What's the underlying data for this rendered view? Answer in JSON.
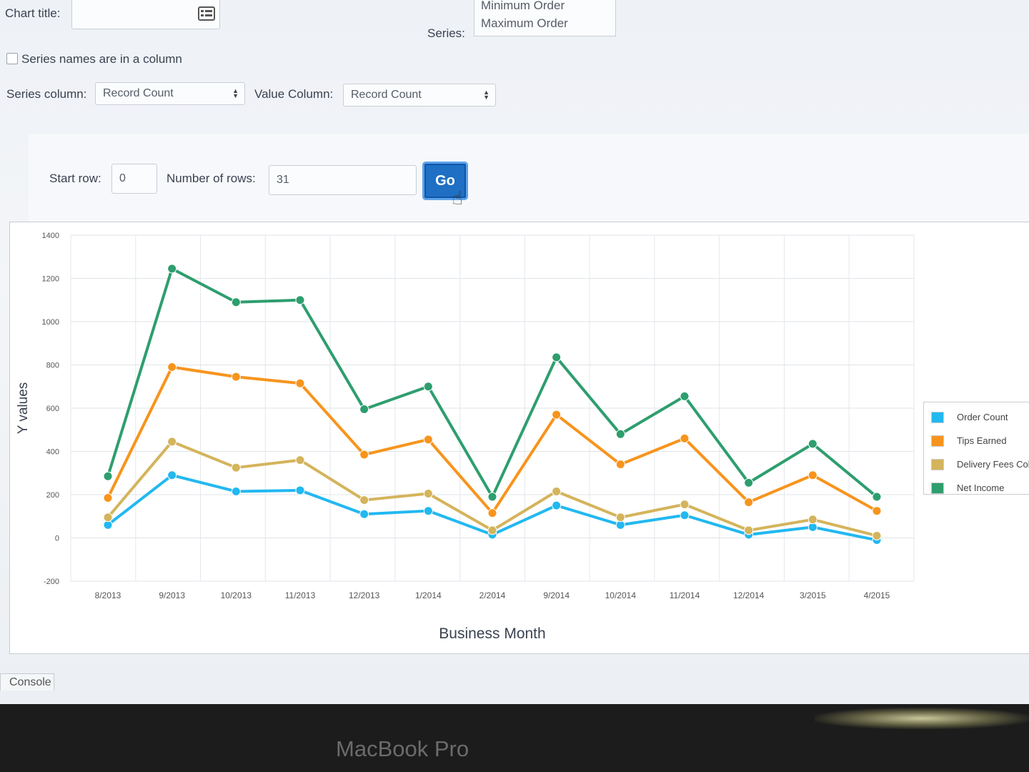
{
  "form": {
    "chart_title_label": "Chart title:",
    "chart_title_value": "",
    "series_label": "Series:",
    "series_options": [
      "Minimum Order",
      "Maximum Order"
    ],
    "series_names_in_column_label": "Series names are in a column",
    "series_names_in_column_checked": false,
    "series_column_label": "Series column:",
    "series_column_value": "Record Count",
    "value_column_label": "Value Column:",
    "value_column_value": "Record Count",
    "start_row_label": "Start row:",
    "start_row_value": "0",
    "num_rows_label": "Number of rows:",
    "num_rows_value": "31",
    "go_label": "Go"
  },
  "chart_data": {
    "type": "line",
    "categories": [
      "8/2013",
      "9/2013",
      "10/2013",
      "11/2013",
      "12/2013",
      "1/2014",
      "2/2014",
      "9/2014",
      "10/2014",
      "11/2014",
      "12/2014",
      "3/2015",
      "4/2015"
    ],
    "series": [
      {
        "name": "Order Count",
        "color": "#22b8f0",
        "values": [
          60,
          290,
          215,
          220,
          110,
          125,
          15,
          150,
          60,
          105,
          15,
          50,
          -10
        ]
      },
      {
        "name": "Tips Earned",
        "color": "#f7941d",
        "values": [
          185,
          790,
          745,
          715,
          385,
          455,
          115,
          570,
          340,
          460,
          165,
          290,
          125
        ]
      },
      {
        "name": "Delivery Fees Coll",
        "color": "#d4b45c",
        "values": [
          95,
          445,
          325,
          360,
          175,
          205,
          35,
          215,
          95,
          155,
          35,
          85,
          10
        ]
      },
      {
        "name": "Net Income",
        "color": "#2e9e6e",
        "values": [
          285,
          1245,
          1090,
          1100,
          595,
          700,
          190,
          835,
          480,
          655,
          255,
          435,
          190
        ]
      }
    ],
    "xlabel": "Business Month",
    "ylabel": "Y values",
    "yticks": [
      -200,
      0,
      200,
      400,
      600,
      800,
      1000,
      1200,
      1400
    ],
    "ylim": [
      -200,
      1400
    ],
    "grid": true,
    "legend": "right"
  },
  "console": {
    "label": "Console"
  },
  "bezel": {
    "brand": "MacBook Pro"
  },
  "icons": {
    "chart_title_field": "form-list-icon",
    "cursor": "hand-pointer-icon"
  }
}
